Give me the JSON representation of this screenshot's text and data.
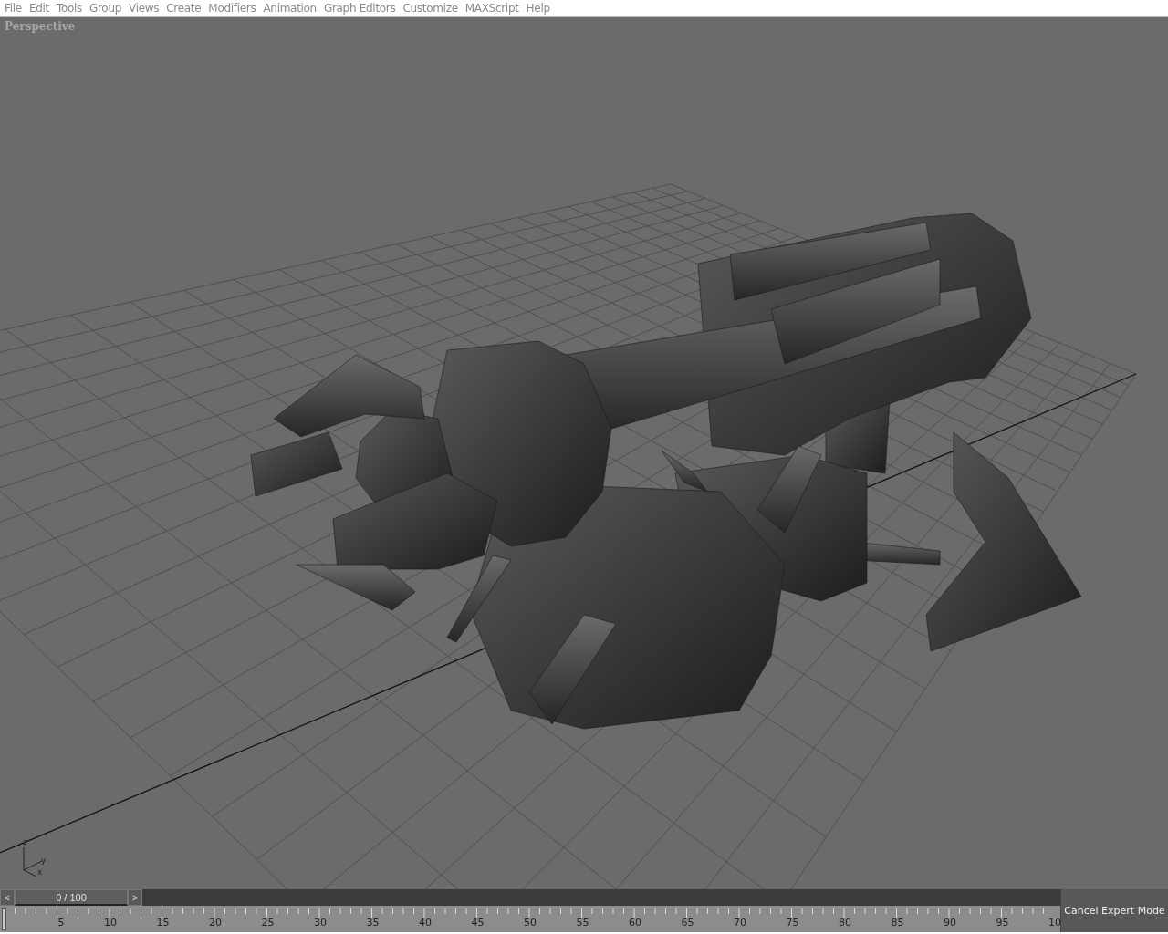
{
  "menu_bar": {
    "items": [
      "File",
      "Edit",
      "Tools",
      "Group",
      "Views",
      "Create",
      "Modifiers",
      "Animation",
      "Graph Editors",
      "Customize",
      "MAXScript",
      "Help"
    ]
  },
  "viewport": {
    "label": "Perspective",
    "axis_labels": [
      "z",
      "y",
      "x"
    ]
  },
  "time_slider": {
    "prev": "<",
    "position": "0 / 100",
    "next": ">"
  },
  "track_bar": {
    "labels": [
      "5",
      "10",
      "15",
      "20",
      "25",
      "30",
      "35",
      "40",
      "45",
      "50",
      "55",
      "60",
      "65",
      "70",
      "75",
      "80",
      "85",
      "90",
      "95",
      "10"
    ]
  },
  "expert_mode_button": {
    "label": "Cancel Expert Mode"
  }
}
